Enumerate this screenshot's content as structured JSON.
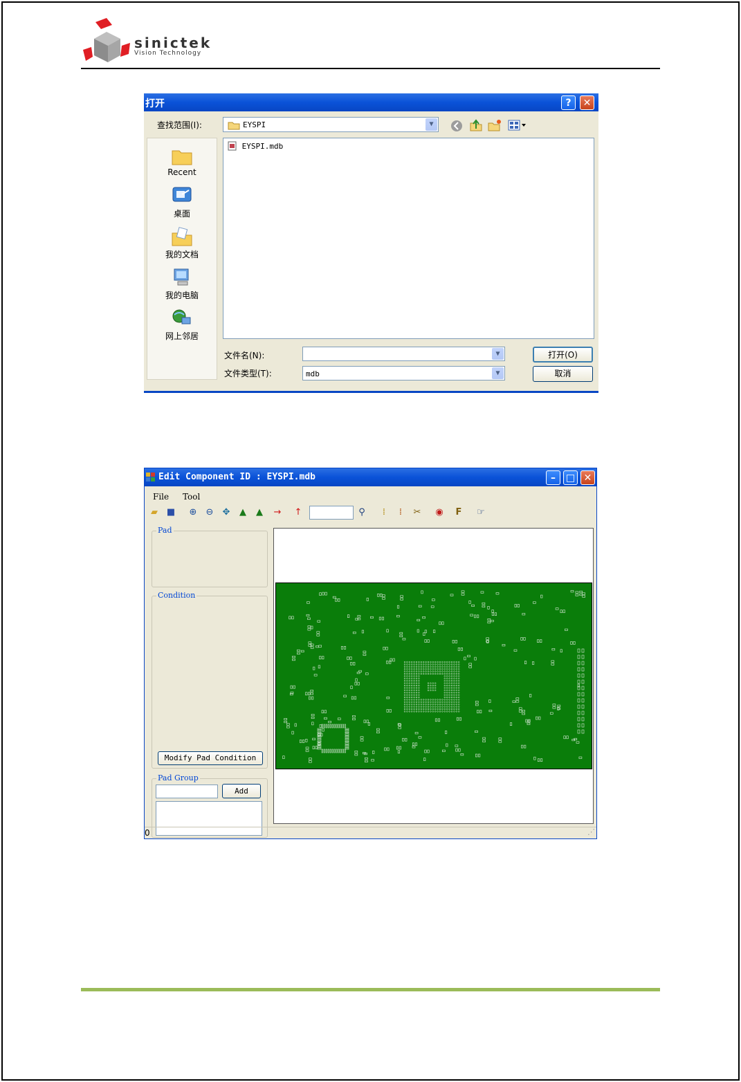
{
  "logo": {
    "name": "sinictek",
    "tagline": "Vision Technology"
  },
  "open_dialog": {
    "title": "打开",
    "help_glyph": "?",
    "close_glyph": "✕",
    "look_in_label": "查找范围(I):",
    "look_in_value": "EYSPI",
    "places": [
      {
        "label": "Recent",
        "icon": "recent-folder-icon"
      },
      {
        "label": "桌面",
        "icon": "desktop-icon"
      },
      {
        "label": "我的文档",
        "icon": "my-documents-icon"
      },
      {
        "label": "我的电脑",
        "icon": "my-computer-icon"
      },
      {
        "label": "网上邻居",
        "icon": "network-places-icon"
      }
    ],
    "files": [
      {
        "name": "EYSPI.mdb",
        "icon": "mdb-file-icon"
      }
    ],
    "filename_label": "文件名(N):",
    "filename_value": "",
    "filetype_label": "文件类型(T):",
    "filetype_value": "mdb",
    "open_button": "打开(O)",
    "cancel_button": "取消"
  },
  "edit_window": {
    "title": "Edit Component ID : EYSPI.mdb",
    "menu": [
      "File",
      "Tool"
    ],
    "pad_group_label": "Pad",
    "condition_group_label": "Condition",
    "modify_button": "Modify Pad Condition",
    "pad_group_section_label": "Pad Group",
    "add_button": "Add",
    "pad_group_input_value": "",
    "search_value": "",
    "status_text": "0",
    "pcb_color": "#0a7d0a"
  }
}
